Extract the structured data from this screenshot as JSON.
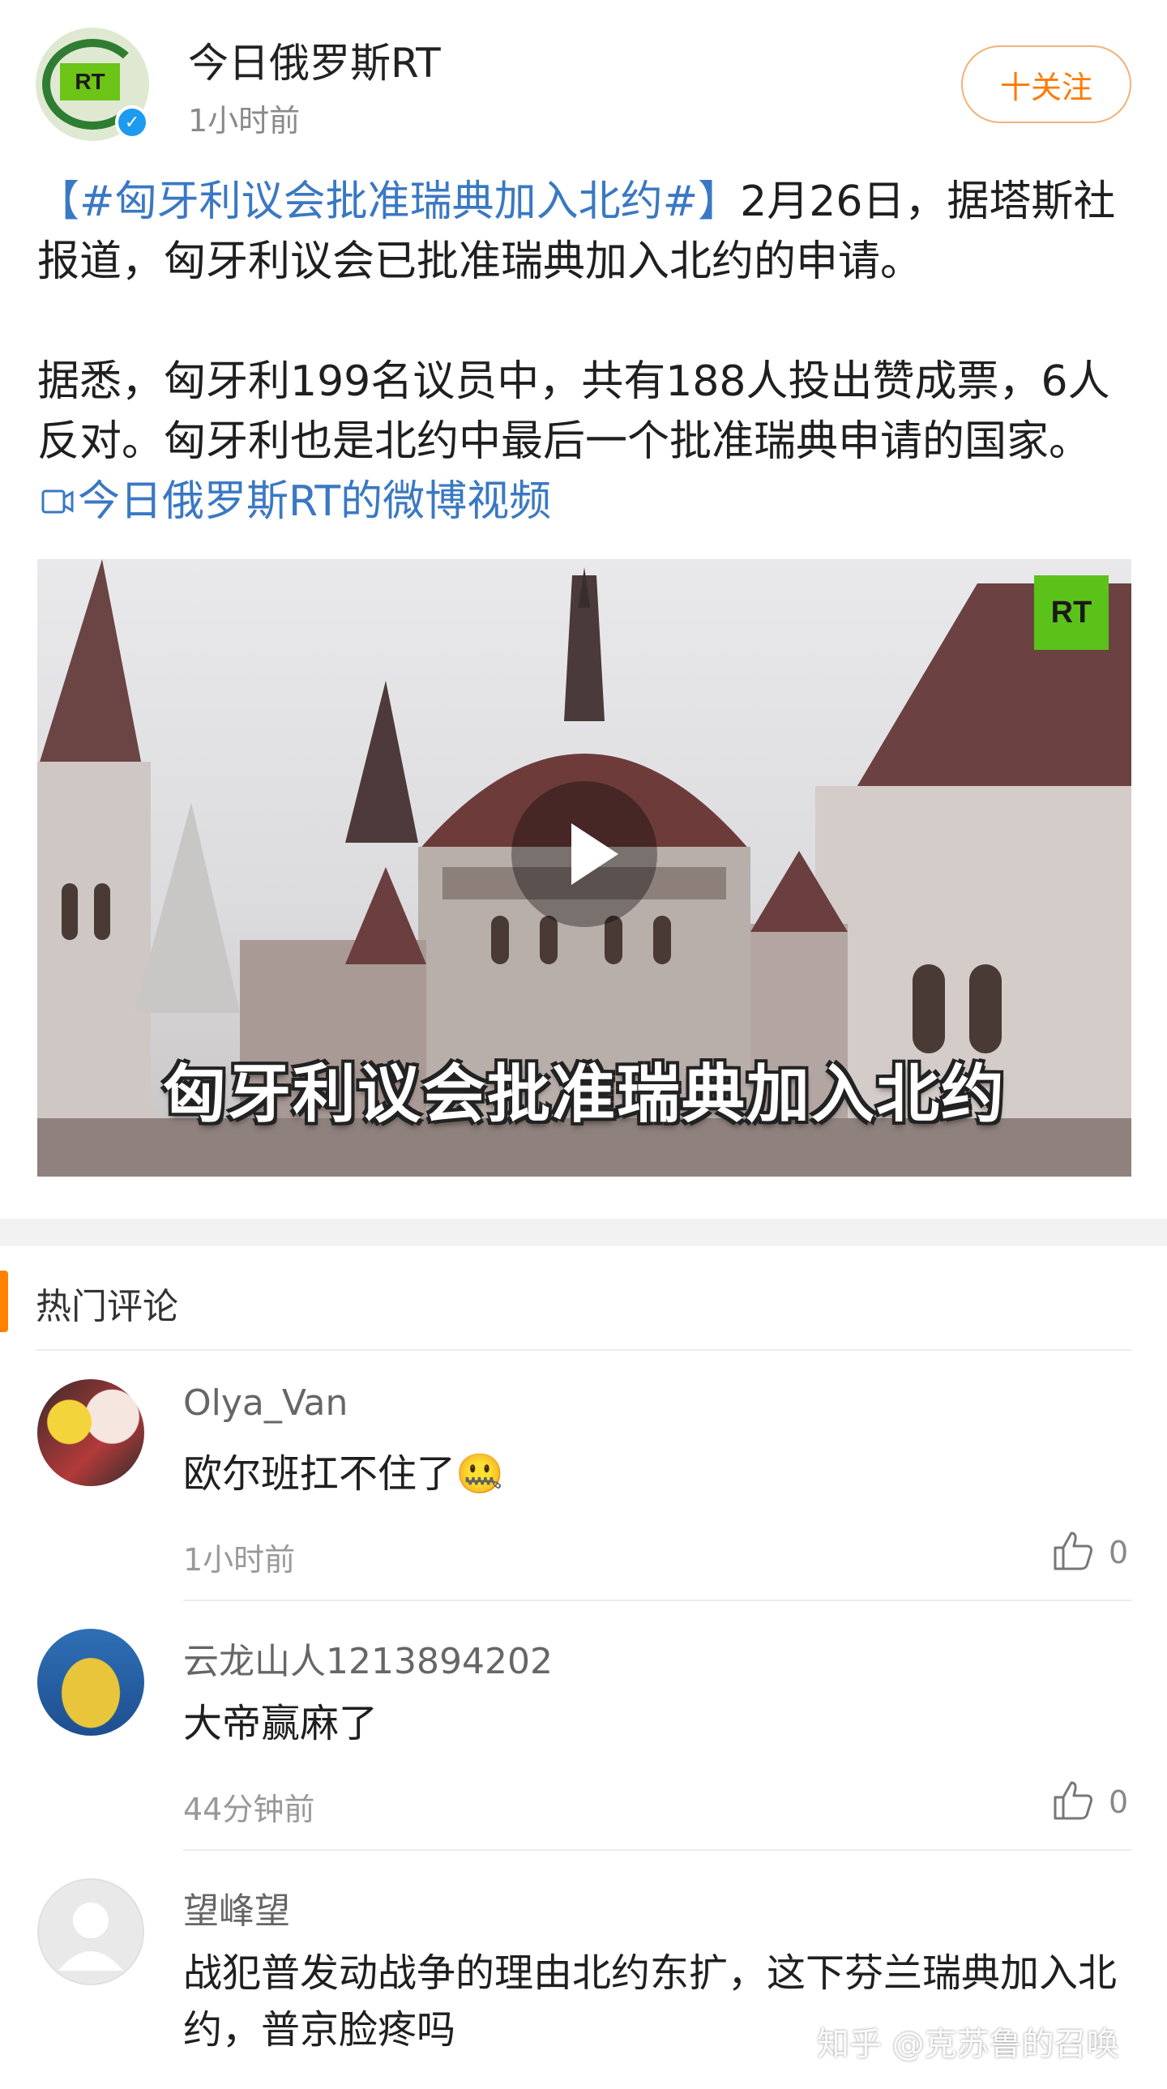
{
  "post": {
    "author": "今日俄罗斯RT",
    "time": "1小时前",
    "follow_label": "十关注",
    "avatar_logo": "RT",
    "verified_icon": "verified-check-icon",
    "text": {
      "hashtag": "【#匈牙利议会批准瑞典加入北约#】",
      "line1_rest": "2月26日，据塔斯社报道，匈牙利议会已批准瑞典加入北约的申请。",
      "para2": "据悉，匈牙利199名议员中，共有188人投出赞成票，6人反对。匈牙利也是北约中最后一个批准瑞典申请的国家。",
      "video_link": "今日俄罗斯RT的微博视频",
      "video_link_icon": "video-camera-icon"
    },
    "video": {
      "caption": "匈牙利议会批准瑞典加入北约",
      "logo": "RT",
      "play_icon": "play-icon"
    }
  },
  "comments_section": {
    "title": "热门评论",
    "items": [
      {
        "name": "Olya_Van",
        "text": "欧尔班扛不住了",
        "emoji": "🤐",
        "time": "1小时前",
        "likes": "0"
      },
      {
        "name": "云龙山人1213894202",
        "text": "大帝赢麻了",
        "emoji": "",
        "time": "44分钟前",
        "likes": "0"
      },
      {
        "name": "望峰望",
        "text": "战犯普发动战争的理由北约东扩，这下芬兰瑞典加入北约，普京脸疼吗",
        "emoji": "",
        "time": "",
        "likes": ""
      }
    ]
  },
  "watermark": "知乎 @克苏鲁的召唤",
  "colors": {
    "accent_orange": "#ff8200",
    "link_blue": "#3a78c3",
    "rt_green": "#5bc21a"
  }
}
